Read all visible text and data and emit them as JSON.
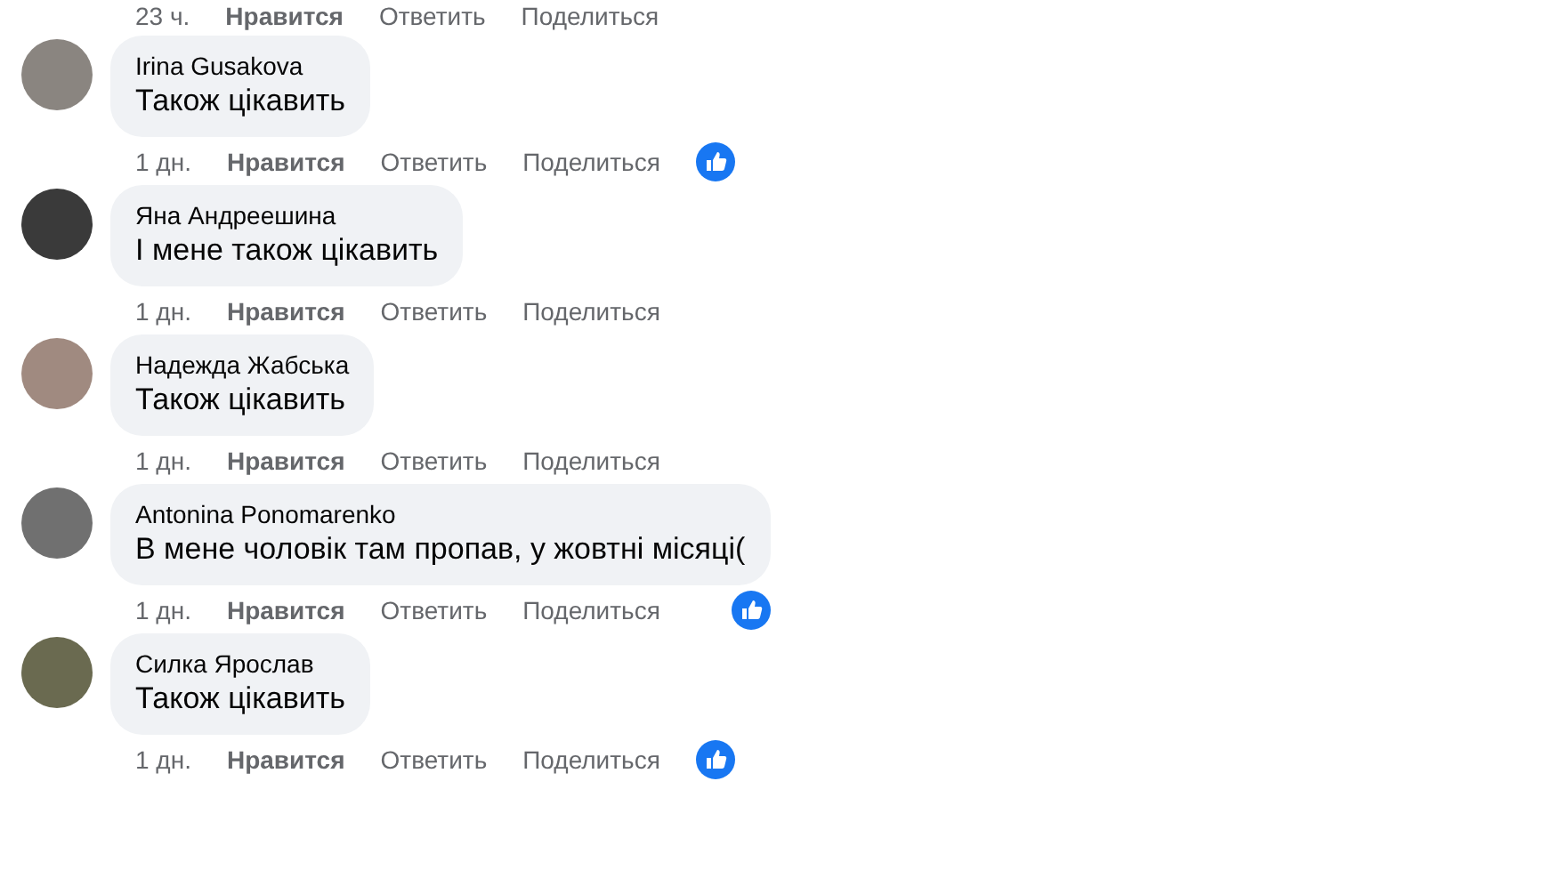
{
  "top_actions": {
    "time": "23 ч.",
    "like": "Нравится",
    "reply": "Ответить",
    "share": "Поделиться"
  },
  "comments": [
    {
      "author": "Irina Gusakova",
      "text": "Також цікавить",
      "time": "1 дн.",
      "like": "Нравится",
      "reply": "Ответить",
      "share": "Поделиться",
      "reacted": true
    },
    {
      "author": "Яна Андреешина",
      "text": "І мене також цікавить",
      "time": "1 дн.",
      "like": "Нравится",
      "reply": "Ответить",
      "share": "Поделиться",
      "reacted": false
    },
    {
      "author": "Надежда Жабська",
      "text": "Також цікавить",
      "time": "1 дн.",
      "like": "Нравится",
      "reply": "Ответить",
      "share": "Поделиться",
      "reacted": false
    },
    {
      "author": "Antonina Ponomarenko",
      "text": "В мене чоловік там пропав, у жовтні місяці(",
      "time": "1 дн.",
      "like": "Нравится",
      "reply": "Ответить",
      "share": "Поделиться",
      "reacted": true
    },
    {
      "author": "Силка Ярослав",
      "text": "Також цікавить",
      "time": "1 дн.",
      "like": "Нравится",
      "reply": "Ответить",
      "share": "Поделиться",
      "reacted": true
    }
  ]
}
